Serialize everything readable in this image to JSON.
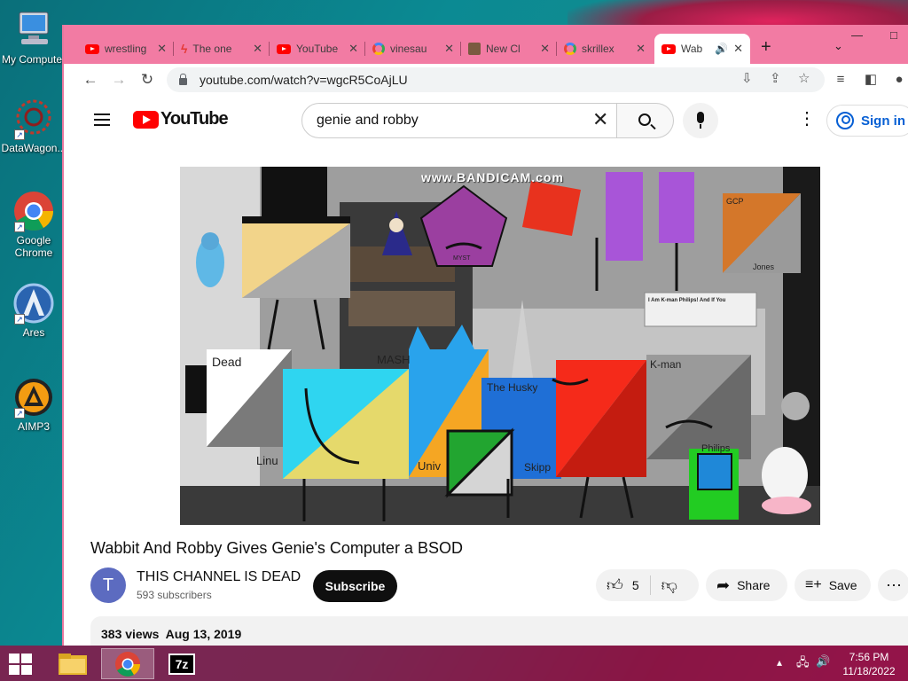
{
  "desktop": {
    "icons": [
      {
        "label": "My Computer",
        "icon": "computer-icon"
      },
      {
        "label": "DataWagon...",
        "icon": "datawagon-icon"
      },
      {
        "label": "Google Chrome",
        "icon": "chrome-icon"
      },
      {
        "label": "Ares",
        "icon": "ares-icon"
      },
      {
        "label": "AIMP3",
        "icon": "aimp-icon"
      }
    ]
  },
  "browser": {
    "tabs": [
      {
        "title": "wrestling",
        "favicon": "youtube"
      },
      {
        "title": "The one",
        "favicon": "bolt"
      },
      {
        "title": "YouTube",
        "favicon": "youtube"
      },
      {
        "title": "vinesau",
        "favicon": "google"
      },
      {
        "title": "New Cl",
        "favicon": "image"
      },
      {
        "title": "skrillex",
        "favicon": "google"
      },
      {
        "title": "Wab",
        "favicon": "youtube",
        "active": true
      }
    ],
    "new_tab": "+",
    "url": "youtube.com/watch?v=wgcR5CoAjLU"
  },
  "youtube": {
    "logo_text": "YouTube",
    "search_value": "genie and robby",
    "sign_in": "Sign in",
    "video": {
      "watermark": "www.BANDICAM.com",
      "caption_box": "I Am K-man Philips! And If You",
      "labels": [
        "Dead",
        "MASH",
        "The Husky",
        "K-man",
        "Linu",
        "Univ",
        "Skipp",
        "Philips",
        "Jones",
        "GCP",
        "MYST"
      ]
    },
    "title": "Wabbit And Robby Gives Genie's Computer a BSOD",
    "channel": {
      "initial": "T",
      "name": "THIS CHANNEL IS DEAD",
      "subscribers": "593 subscribers",
      "subscribe": "Subscribe"
    },
    "actions": {
      "likes": "5",
      "share": "Share",
      "save": "Save"
    },
    "meta": "383 views  Aug 13, 2019"
  },
  "taskbar": {
    "time": "7:56 PM",
    "date": "11/18/2022",
    "apps": [
      "file-explorer",
      "chrome",
      "7zip"
    ],
    "sevenzip_label": "7z"
  },
  "colors": {
    "tabstrip": "#f27ba3",
    "taskbar": "#8c1446",
    "youtube_red": "#ff0000",
    "signin_blue": "#065fd4"
  }
}
